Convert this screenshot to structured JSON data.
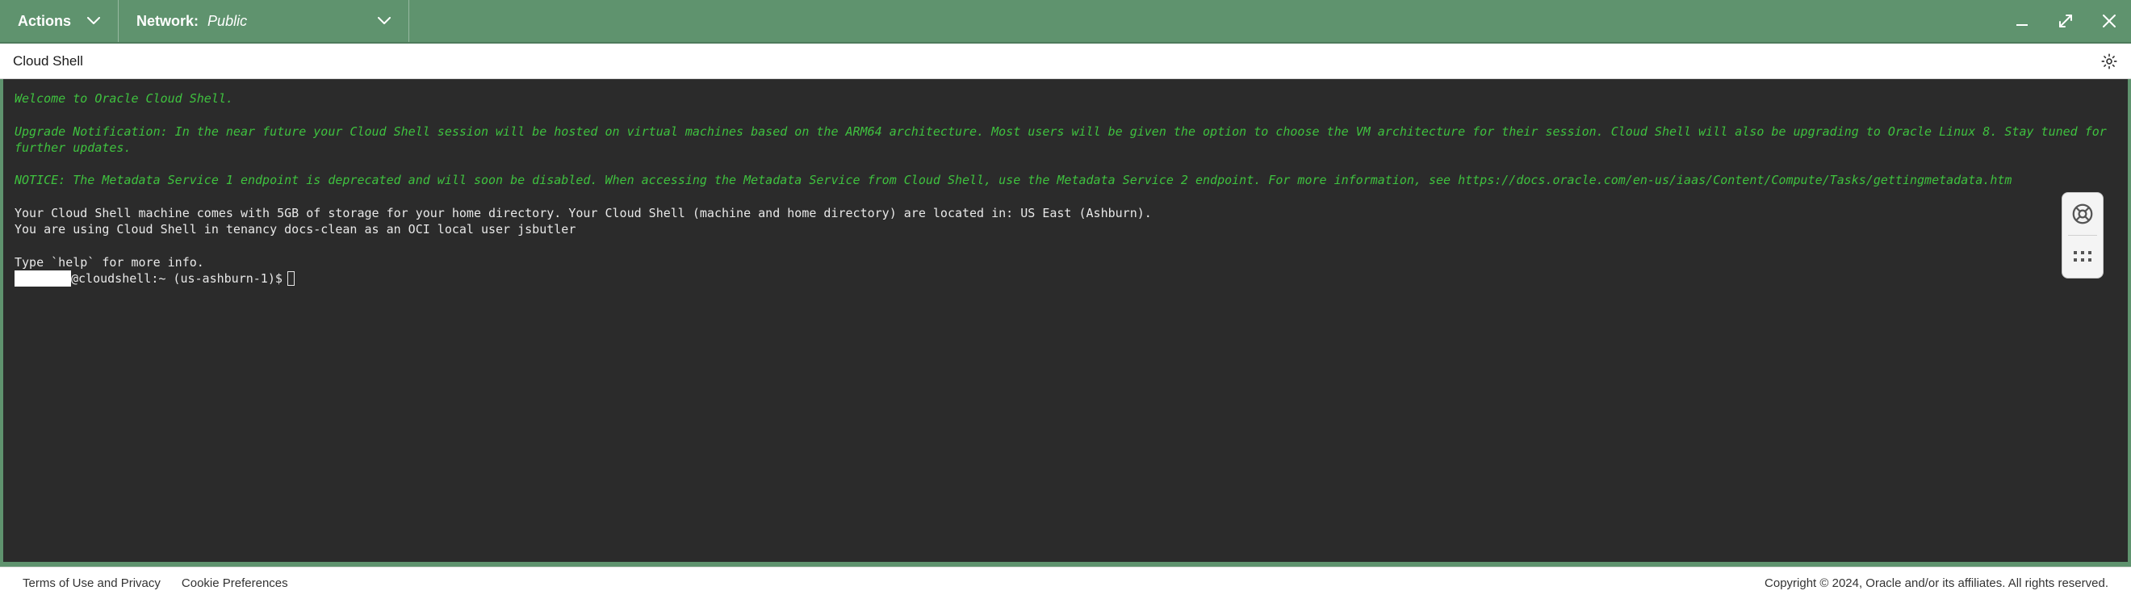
{
  "topbar": {
    "actions_label": "Actions",
    "network_label": "Network:",
    "network_value": "Public"
  },
  "titlebar": {
    "title": "Cloud Shell"
  },
  "terminal": {
    "welcome": "Welcome to Oracle Cloud Shell.",
    "upgrade_notice": "Upgrade Notification: In the near future your Cloud Shell session will be hosted on virtual machines based on the ARM64 architecture. Most users will be given the option to choose the VM architecture for their session. Cloud Shell will also be upgrading to Oracle Linux 8. Stay tuned for further updates.",
    "metadata_notice": "NOTICE: The Metadata Service 1 endpoint is deprecated and will soon be disabled. When accessing the Metadata Service from Cloud Shell, use the Metadata Service 2 endpoint. For more information, see https://docs.oracle.com/en-us/iaas/Content/Compute/Tasks/gettingmetadata.htm",
    "storage_line": "Your Cloud Shell machine comes with 5GB of storage for your home directory. Your Cloud Shell (machine and home directory) are located in: US East (Ashburn).",
    "tenancy_line": "You are using Cloud Shell in tenancy docs-clean as an OCI local user jsbutler",
    "help_line": "Type `help` for more info.",
    "prompt_suffix": "@cloudshell:~ (us-ashburn-1)$"
  },
  "footer": {
    "terms": "Terms of Use and Privacy",
    "cookies": "Cookie Preferences",
    "copyright": "Copyright © 2024, Oracle and/or its affiliates. All rights reserved."
  }
}
